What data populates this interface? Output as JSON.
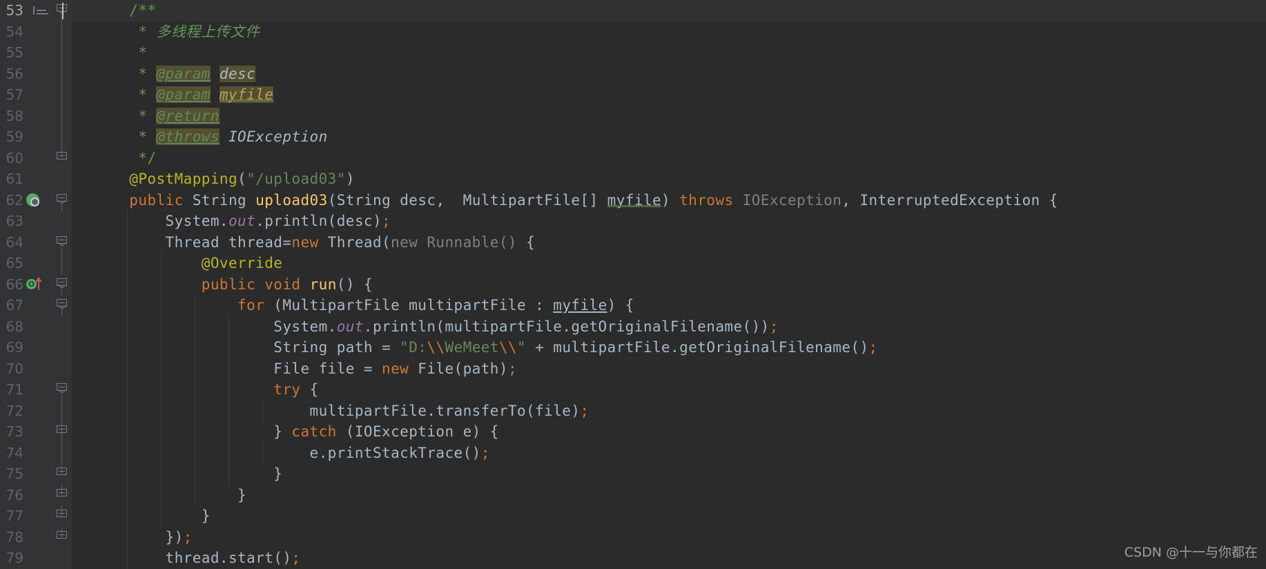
{
  "window": {
    "app": "IntelliJ IDEA",
    "theme_background": "#2b2b2b",
    "gutter_background": "#313335",
    "current_line_background": "#323232",
    "tab_accent_color": "#2d568f",
    "language": "Java"
  },
  "watermark": {
    "text": "CSDN @十一与你都在"
  },
  "gutter": {
    "format_icon_name": "format-lines-icon",
    "spring_bean_icon_name": "spring-bean-icon",
    "override_icon_name": "override-method-icon",
    "override_icon_label": "O"
  },
  "editor": {
    "first_line_number": 53,
    "last_line_number": 79,
    "current_line_number": 53,
    "caret_line": 53,
    "lines": [
      {
        "number": "53",
        "current": true,
        "gutter_icon": "none",
        "fold": "cap-start",
        "tokens": [
          {
            "text": "    ",
            "cls": "t-default"
          },
          {
            "text": "/**",
            "cls": "t-javadoc"
          }
        ]
      },
      {
        "number": "54",
        "current": false,
        "gutter_icon": "none",
        "fold": "line",
        "tokens": [
          {
            "text": "     * ",
            "cls": "t-javadoc"
          },
          {
            "text": "多线程上传文件",
            "cls": "t-javadoc",
            "italic": true
          }
        ]
      },
      {
        "number": "55",
        "current": false,
        "gutter_icon": "none",
        "fold": "line",
        "tokens": [
          {
            "text": "     *",
            "cls": "t-javadoc"
          }
        ]
      },
      {
        "number": "56",
        "current": false,
        "gutter_icon": "none",
        "fold": "line",
        "tokens": [
          {
            "text": "     * ",
            "cls": "t-javadoc"
          },
          {
            "text": "@param",
            "cls": "t-doctag",
            "hl": "box"
          },
          {
            "text": " ",
            "cls": "t-javadoc"
          },
          {
            "text": "desc",
            "cls": "t-docval",
            "hl": "box"
          }
        ]
      },
      {
        "number": "57",
        "current": false,
        "gutter_icon": "none",
        "fold": "line",
        "tokens": [
          {
            "text": "     * ",
            "cls": "t-javadoc"
          },
          {
            "text": "@param",
            "cls": "t-doctag",
            "hl": "box"
          },
          {
            "text": " ",
            "cls": "t-javadoc"
          },
          {
            "text": "myfile",
            "cls": "t-param-warn",
            "hl": "box",
            "squiggle": true
          }
        ]
      },
      {
        "number": "58",
        "current": false,
        "gutter_icon": "none",
        "fold": "line",
        "tokens": [
          {
            "text": "     * ",
            "cls": "t-javadoc"
          },
          {
            "text": "@return",
            "cls": "t-doctag",
            "hl": "box"
          }
        ]
      },
      {
        "number": "59",
        "current": false,
        "gutter_icon": "none",
        "fold": "line",
        "tokens": [
          {
            "text": "     * ",
            "cls": "t-javadoc"
          },
          {
            "text": "@throws",
            "cls": "t-doctag",
            "hl": "box"
          },
          {
            "text": " ",
            "cls": "t-javadoc"
          },
          {
            "text": "IOException",
            "cls": "t-docval"
          }
        ]
      },
      {
        "number": "60",
        "current": false,
        "gutter_icon": "none",
        "fold": "cap-end",
        "tokens": [
          {
            "text": "     */",
            "cls": "t-javadoc"
          }
        ]
      },
      {
        "number": "61",
        "current": false,
        "gutter_icon": "none",
        "fold": "none",
        "tokens": [
          {
            "text": "    ",
            "cls": "t-default"
          },
          {
            "text": "@PostMapping",
            "cls": "t-annotation"
          },
          {
            "text": "(",
            "cls": "t-default"
          },
          {
            "text": "\"/upload03\"",
            "cls": "t-string"
          },
          {
            "text": ")",
            "cls": "t-default"
          }
        ]
      },
      {
        "number": "62",
        "current": false,
        "gutter_icon": "spring",
        "fold": "cap-start",
        "tokens": [
          {
            "text": "    ",
            "cls": "t-default"
          },
          {
            "text": "public",
            "cls": "t-keyword"
          },
          {
            "text": " String ",
            "cls": "t-default"
          },
          {
            "text": "upload03",
            "cls": "t-method"
          },
          {
            "text": "(String desc,  MultipartFile[] ",
            "cls": "t-default"
          },
          {
            "text": "myfile",
            "cls": "t-default",
            "squiggle": true
          },
          {
            "text": ") ",
            "cls": "t-default"
          },
          {
            "text": "throws",
            "cls": "t-keyword"
          },
          {
            "text": " ",
            "cls": "t-default"
          },
          {
            "text": "IOException",
            "cls": "t-dim"
          },
          {
            "text": ", InterruptedException {",
            "cls": "t-default"
          }
        ]
      },
      {
        "number": "63",
        "current": false,
        "gutter_icon": "none",
        "fold": "none",
        "indents": [
          1
        ],
        "tokens": [
          {
            "text": "        System.",
            "cls": "t-default"
          },
          {
            "text": "out",
            "cls": "t-static"
          },
          {
            "text": ".println(desc)",
            "cls": "t-default"
          },
          {
            "text": ";",
            "cls": "t-semi"
          }
        ]
      },
      {
        "number": "64",
        "current": false,
        "gutter_icon": "none",
        "fold": "cap-start",
        "indents": [
          1
        ],
        "tokens": [
          {
            "text": "        Thread thread=",
            "cls": "t-default"
          },
          {
            "text": "new",
            "cls": "t-keyword"
          },
          {
            "text": " Thread(",
            "cls": "t-default"
          },
          {
            "text": "new Runnable()",
            "cls": "t-dim"
          },
          {
            "text": " {",
            "cls": "t-default"
          }
        ]
      },
      {
        "number": "65",
        "current": false,
        "gutter_icon": "none",
        "fold": "line",
        "indents": [
          1,
          2
        ],
        "tokens": [
          {
            "text": "            ",
            "cls": "t-default"
          },
          {
            "text": "@Override",
            "cls": "t-annotation"
          }
        ]
      },
      {
        "number": "66",
        "current": false,
        "gutter_icon": "override",
        "fold": "cap-start",
        "indents": [
          1,
          2
        ],
        "tokens": [
          {
            "text": "            ",
            "cls": "t-default"
          },
          {
            "text": "public",
            "cls": "t-keyword"
          },
          {
            "text": " ",
            "cls": "t-default"
          },
          {
            "text": "void",
            "cls": "t-keyword"
          },
          {
            "text": " ",
            "cls": "t-default"
          },
          {
            "text": "run",
            "cls": "t-method"
          },
          {
            "text": "() {",
            "cls": "t-default"
          }
        ]
      },
      {
        "number": "67",
        "current": false,
        "gutter_icon": "none",
        "fold": "cap-start",
        "indents": [
          1,
          2,
          3
        ],
        "tokens": [
          {
            "text": "                ",
            "cls": "t-default"
          },
          {
            "text": "for",
            "cls": "t-keyword"
          },
          {
            "text": " (MultipartFile multipartFile : ",
            "cls": "t-default"
          },
          {
            "text": "myfile",
            "cls": "t-field-u"
          },
          {
            "text": ") {",
            "cls": "t-default"
          }
        ]
      },
      {
        "number": "68",
        "current": false,
        "gutter_icon": "none",
        "fold": "none",
        "indents": [
          1,
          2,
          3,
          4
        ],
        "tokens": [
          {
            "text": "                    System.",
            "cls": "t-default"
          },
          {
            "text": "out",
            "cls": "t-static"
          },
          {
            "text": ".println(multipartFile.getOriginalFilename())",
            "cls": "t-default"
          },
          {
            "text": ";",
            "cls": "t-semi"
          }
        ]
      },
      {
        "number": "69",
        "current": false,
        "gutter_icon": "none",
        "fold": "none",
        "indents": [
          1,
          2,
          3,
          4
        ],
        "tokens": [
          {
            "text": "                    String path = ",
            "cls": "t-default"
          },
          {
            "text": "\"D:",
            "cls": "t-string"
          },
          {
            "text": "\\\\",
            "cls": "t-escape"
          },
          {
            "text": "WeMeet",
            "cls": "t-string"
          },
          {
            "text": "\\\\",
            "cls": "t-escape"
          },
          {
            "text": "\"",
            "cls": "t-string"
          },
          {
            "text": " + multipartFile.getOriginalFilename()",
            "cls": "t-default"
          },
          {
            "text": ";",
            "cls": "t-semi"
          }
        ]
      },
      {
        "number": "70",
        "current": false,
        "gutter_icon": "none",
        "fold": "none",
        "indents": [
          1,
          2,
          3,
          4
        ],
        "tokens": [
          {
            "text": "                    File file = ",
            "cls": "t-default"
          },
          {
            "text": "new",
            "cls": "t-keyword"
          },
          {
            "text": " File(path)",
            "cls": "t-default"
          },
          {
            "text": ";",
            "cls": "t-semi"
          }
        ]
      },
      {
        "number": "71",
        "current": false,
        "gutter_icon": "none",
        "fold": "cap-start",
        "indents": [
          1,
          2,
          3,
          4
        ],
        "tokens": [
          {
            "text": "                    ",
            "cls": "t-default"
          },
          {
            "text": "try",
            "cls": "t-keyword"
          },
          {
            "text": " {",
            "cls": "t-default"
          }
        ]
      },
      {
        "number": "72",
        "current": false,
        "gutter_icon": "none",
        "fold": "line",
        "indents": [
          1,
          2,
          3,
          4,
          5
        ],
        "tokens": [
          {
            "text": "                        multipartFile.transferTo(file)",
            "cls": "t-default"
          },
          {
            "text": ";",
            "cls": "t-semi"
          }
        ]
      },
      {
        "number": "73",
        "current": false,
        "gutter_icon": "none",
        "fold": "cap-both",
        "indents": [
          1,
          2,
          3,
          4
        ],
        "tokens": [
          {
            "text": "                    } ",
            "cls": "t-default"
          },
          {
            "text": "catch",
            "cls": "t-keyword"
          },
          {
            "text": " (IOException e) {",
            "cls": "t-default"
          }
        ]
      },
      {
        "number": "74",
        "current": false,
        "gutter_icon": "none",
        "fold": "line",
        "indents": [
          1,
          2,
          3,
          4,
          5
        ],
        "tokens": [
          {
            "text": "                        e.printStackTrace()",
            "cls": "t-default"
          },
          {
            "text": ";",
            "cls": "t-semi"
          }
        ]
      },
      {
        "number": "75",
        "current": false,
        "gutter_icon": "none",
        "fold": "cap-end",
        "indents": [
          1,
          2,
          3,
          4
        ],
        "tokens": [
          {
            "text": "                    }",
            "cls": "t-default"
          }
        ]
      },
      {
        "number": "76",
        "current": false,
        "gutter_icon": "none",
        "fold": "cap-end",
        "indents": [
          1,
          2,
          3
        ],
        "tokens": [
          {
            "text": "                }",
            "cls": "t-default"
          }
        ]
      },
      {
        "number": "77",
        "current": false,
        "gutter_icon": "none",
        "fold": "cap-end",
        "indents": [
          1,
          2
        ],
        "tokens": [
          {
            "text": "            }",
            "cls": "t-default"
          }
        ]
      },
      {
        "number": "78",
        "current": false,
        "gutter_icon": "none",
        "fold": "cap-end",
        "indents": [
          1
        ],
        "tokens": [
          {
            "text": "        })",
            "cls": "t-default"
          },
          {
            "text": ";",
            "cls": "t-semi"
          }
        ]
      },
      {
        "number": "79",
        "current": false,
        "gutter_icon": "none",
        "fold": "none",
        "indents": [
          1
        ],
        "tokens": [
          {
            "text": "        thread.start()",
            "cls": "t-default"
          },
          {
            "text": ";",
            "cls": "t-semi"
          }
        ]
      }
    ]
  }
}
